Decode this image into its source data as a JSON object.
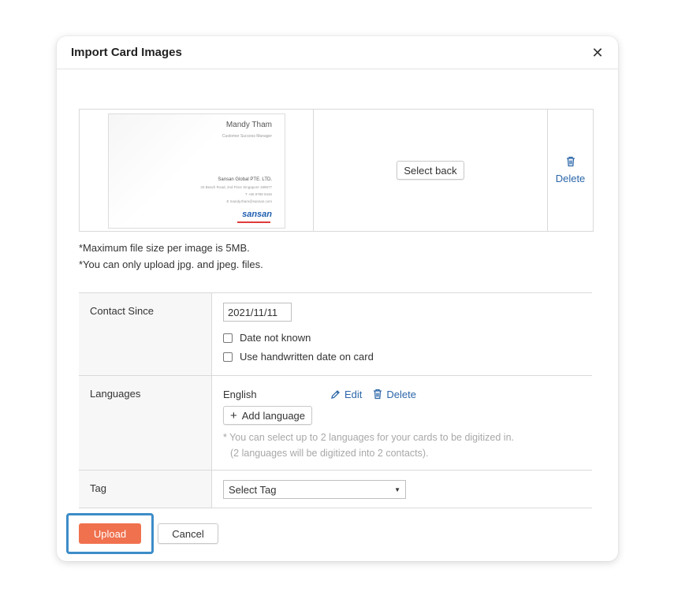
{
  "dialog": {
    "title": "Import Card Images",
    "close_icon": "close-icon"
  },
  "card_row": {
    "front": {
      "name": "Mandy Tham",
      "role": "Customer Success Manager",
      "company": "Sansan Global PTE. LTD.",
      "address": "33 Beach Road, 2nd Floor Singapore 189677",
      "phone": "T +65 9788 9446",
      "email": "E mandy.tham@sansan.com",
      "logo": "sansan"
    },
    "select_back_label": "Select back",
    "delete_label": "Delete",
    "delete_icon": "trash-icon"
  },
  "notes": {
    "size_note": "*Maximum file size per image is 5MB.",
    "type_note": "*You can only upload jpg. and jpeg. files."
  },
  "form": {
    "contact_since": {
      "label": "Contact Since",
      "date_value": "2021/11/11",
      "date_not_known": "Date not known",
      "handwritten": "Use handwritten date on card"
    },
    "languages": {
      "label": "Languages",
      "current": "English",
      "edit_label": "Edit",
      "delete_label": "Delete",
      "add_label": "Add language",
      "hint_line1": "* You can select up to 2 languages for your cards to be digitized in.",
      "hint_line2": "(2 languages will be digitized into 2 contacts)."
    },
    "tag": {
      "label": "Tag",
      "select_value": "Select Tag"
    }
  },
  "footer": {
    "upload_label": "Upload",
    "cancel_label": "Cancel"
  },
  "colors": {
    "accent": "#f0714e",
    "link": "#2b66a8",
    "highlight": "#3d8cc8"
  }
}
